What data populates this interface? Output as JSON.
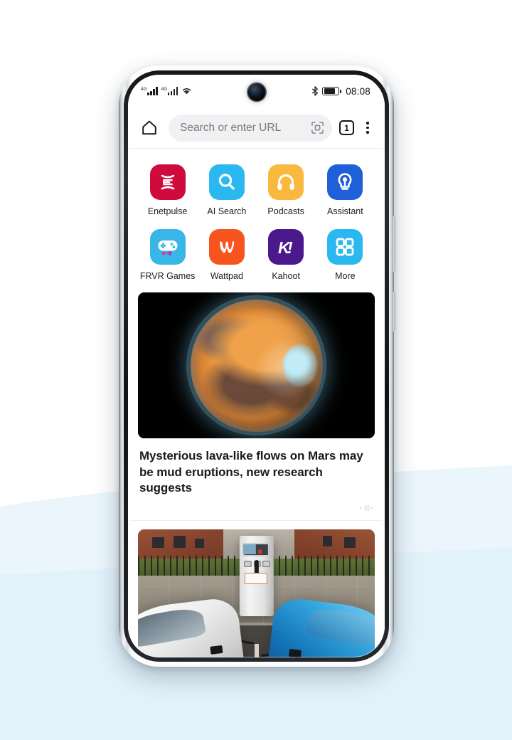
{
  "background": {
    "top_color": "#ffffff",
    "wave_color_1": "#eaf6fc",
    "wave_color_2": "#e1f1fa"
  },
  "device": {
    "frame_color": "#d7dbde",
    "bezel_color": "#14171a",
    "buttons": [
      {
        "name": "volume-rocker"
      },
      {
        "name": "power-button"
      }
    ]
  },
  "statusbar": {
    "signal_1_label": "4G",
    "signal_2_label": "4G",
    "wifi_icon": "wifi-icon",
    "bluetooth_icon": "bluetooth-icon",
    "battery_icon": "battery-icon",
    "time": "08:08"
  },
  "topbar": {
    "home_icon": "home-icon",
    "search": {
      "value": "",
      "placeholder": "Search or enter URL",
      "scan_icon": "qr-scan-icon"
    },
    "tab_count": "1",
    "menu_icon": "kebab-menu-icon"
  },
  "shortcuts": [
    {
      "label": "Enetpulse",
      "icon": "enetpulse-icon",
      "bg": "#cf0a3c",
      "fg": "#ffffff"
    },
    {
      "label": "AI Search",
      "icon": "ai-search-icon",
      "bg": "#2bb8f0",
      "fg": "#ffffff"
    },
    {
      "label": "Podcasts",
      "icon": "podcasts-icon",
      "bg": "#f9b93f",
      "fg": "#ffffff"
    },
    {
      "label": "Assistant",
      "icon": "assistant-icon",
      "bg": "#1f5fd8",
      "fg": "#ffffff"
    },
    {
      "label": "FRVR Games",
      "icon": "frvr-games-icon",
      "bg": "#39b6e8",
      "fg": "#ffffff"
    },
    {
      "label": "Wattpad",
      "icon": "wattpad-icon",
      "bg": "#f7541f",
      "fg": "#ffffff"
    },
    {
      "label": "Kahoot",
      "icon": "kahoot-icon",
      "bg": "#4a1a8c",
      "fg": "#ffffff"
    },
    {
      "label": "More",
      "icon": "more-grid-icon",
      "bg": "#2bb8f0",
      "fg": "#ffffff"
    }
  ],
  "feed": [
    {
      "image": "mars-planet-photo",
      "title": "Mysterious lava-like flows on Mars may be mud eruptions, new research suggests",
      "options_icon": "article-options-icon"
    },
    {
      "image": "ev-charging-station-photo",
      "title": ""
    }
  ]
}
